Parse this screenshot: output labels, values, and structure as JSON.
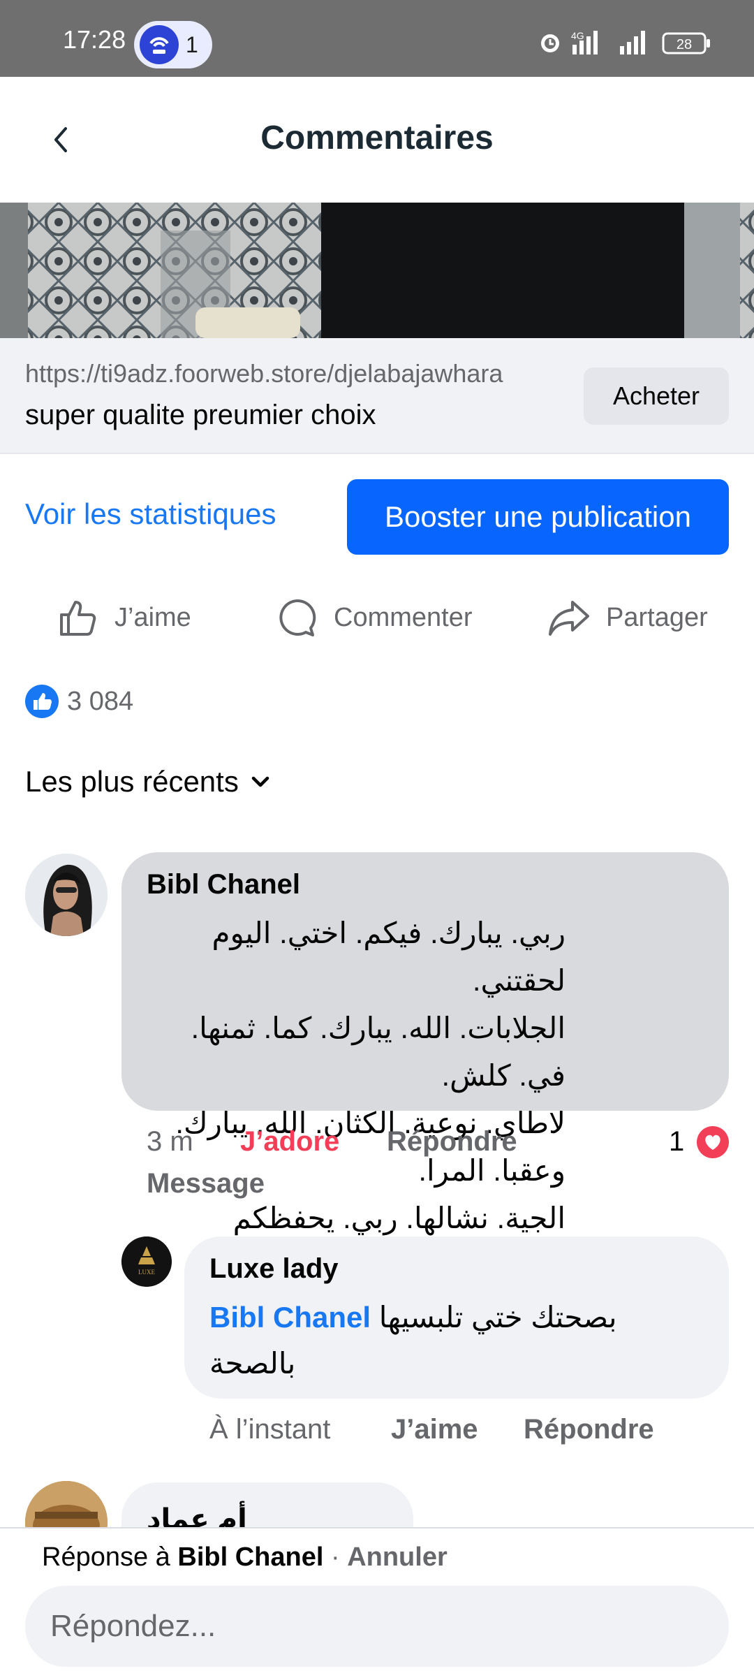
{
  "status_bar": {
    "time": "17:28",
    "notification_count": "1",
    "network": "4G",
    "battery": "28"
  },
  "header": {
    "title": "Commentaires"
  },
  "link_preview": {
    "url": "https://ti9adz.foorweb.store/djelabajawhara",
    "title": "super qualite preumier choix",
    "button": "Acheter"
  },
  "post_actions": {
    "stats": "Voir les statistiques",
    "boost": "Booster une publication",
    "like": "J’aime",
    "comment": "Commenter",
    "share": "Partager"
  },
  "reactions": {
    "count": "3 084"
  },
  "sort": {
    "label": "Les plus récents"
  },
  "comments": [
    {
      "author": "Bibl Chanel",
      "lines": [
        "ربي. يبارك. فيكم. اختي. اليوم لحقتني.",
        "الجلابات. الله. يبارك. كما. ثمنها. في. كلش.",
        "لاطاي. نوعية. الكثان. الله. يبارك. وعقبا. المرا.",
        "الجية. نشالها. ربي. يحفظكم"
      ],
      "time": "3 m",
      "reaction_label": "J’adore",
      "reply_label": "Répondre",
      "message_label": "Message",
      "reaction_count": "1"
    }
  ],
  "reply": {
    "author": "Luxe lady",
    "mention": "Bibl Chanel",
    "text_line1": "بصحتك ختي تلبسيها",
    "text_line2": "بالصحة",
    "time": "À l’instant",
    "like_label": "J’aime",
    "reply_label": "Répondre",
    "avatar_text": "LUXE"
  },
  "next_comment": {
    "author": "أم عماد"
  },
  "reply_bar": {
    "prefix": "Réponse à",
    "target": "Bibl Chanel",
    "separator": "·",
    "cancel": "Annuler",
    "placeholder": "Répondez..."
  },
  "colors": {
    "accent": "#1877f2",
    "boost": "#0866ff",
    "love": "#f33e58",
    "bubble_main": "#d9dadd",
    "bubble_reply": "#f0f2f5"
  }
}
